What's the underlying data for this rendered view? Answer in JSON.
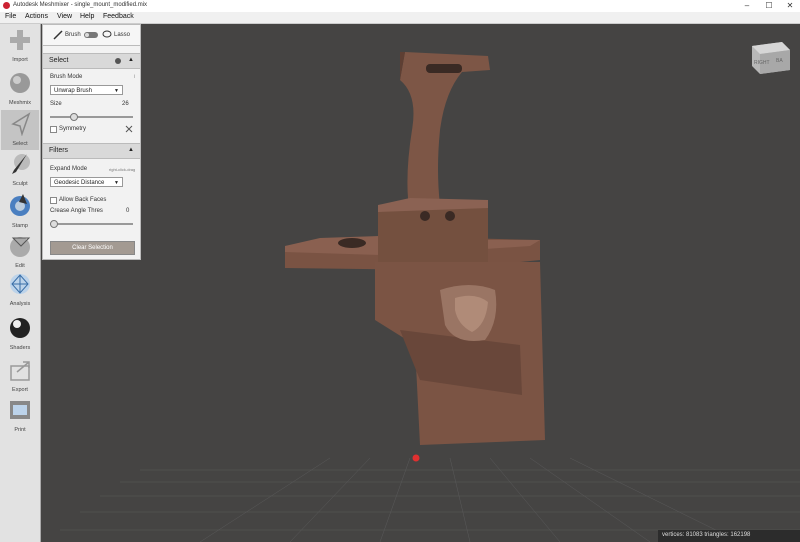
{
  "window": {
    "title": "Autodesk Meshmixer - single_mount_modified.mix",
    "min": "–",
    "max": "☐",
    "close": "✕"
  },
  "menu": [
    "File",
    "Actions",
    "View",
    "Help",
    "Feedback"
  ],
  "tools": [
    {
      "label": "Import",
      "icon": "plus-icon"
    },
    {
      "label": "Meshmix",
      "icon": "sphere-icon"
    },
    {
      "label": "Select",
      "icon": "cursor-icon"
    },
    {
      "label": "Sculpt",
      "icon": "brush-icon"
    },
    {
      "label": "Stamp",
      "icon": "stamp-icon"
    },
    {
      "label": "Edit",
      "icon": "edit-icon"
    },
    {
      "label": "Analysis",
      "icon": "analysis-icon"
    },
    {
      "label": "Shaders",
      "icon": "shader-ball-icon"
    },
    {
      "label": "Export",
      "icon": "export-icon"
    },
    {
      "label": "Print",
      "icon": "print-icon"
    }
  ],
  "panel": {
    "brush_label": "Brush",
    "lasso_label": "Lasso",
    "select_title": "Select",
    "select_info": "i",
    "brush_mode_label": "Brush Mode",
    "brush_mode_value": "Unwrap Brush",
    "size_label": "Size",
    "size_value": "26",
    "size_fraction": 0.26,
    "symmetry_label": "Symmetry",
    "filters_title": "Filters",
    "expand_mode_label": "Expand Mode",
    "expand_mode_hint": "right-click-drag",
    "expand_mode_value": "Geodesic Distance",
    "allow_back_faces_label": "Allow Back Faces",
    "crease_angle_label": "Crease Angle Thres",
    "crease_angle_value": "0",
    "crease_fraction": 0,
    "clear_selection_label": "Clear Selection"
  },
  "viewcube": {
    "right": "RIGHT",
    "back": "BA"
  },
  "status": "vertices: 81083 triangles: 162198",
  "colors": {
    "viewport": "#444444",
    "model": "#7d5646",
    "accent_button": "#a39a92"
  }
}
